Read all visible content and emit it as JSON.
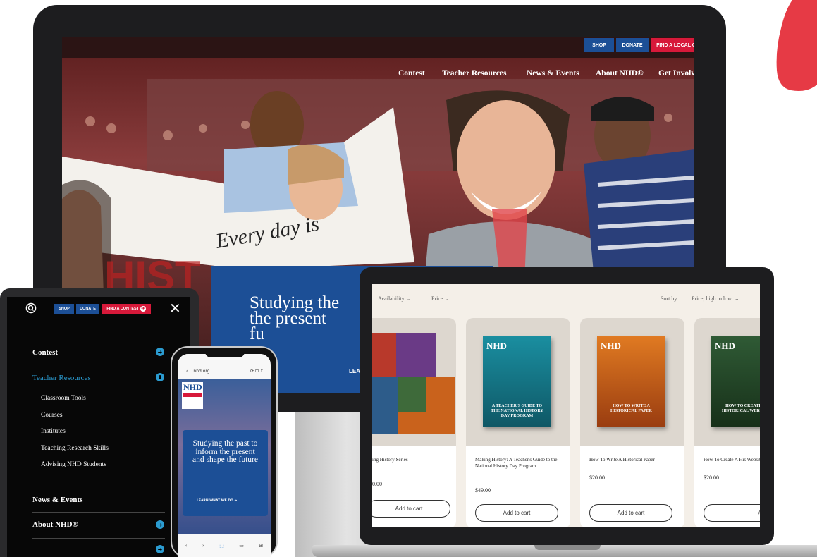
{
  "desktop_site": {
    "top_buttons": [
      {
        "label": "SHOP",
        "color": "#1c4f96"
      },
      {
        "label": "DONATE",
        "color": "#1c4f96"
      },
      {
        "label": "FIND A LOCAL C",
        "color": "#d7193a"
      }
    ],
    "nav": [
      "Contest",
      "Teacher Resources",
      "News & Events",
      "About NHD®",
      "Get Involv"
    ],
    "banner_text": "Every day is",
    "hero_title": "Studying the past to inform the present and shape the future",
    "hero_title_visible": "Studying the\nthe present\nfu",
    "hero_link": "LEARN"
  },
  "shop_page": {
    "filters": {
      "availability": "Availability",
      "price": "Price",
      "sort_label": "Sort by:",
      "sort_value": "Price, high to low"
    },
    "products": [
      {
        "title": "Making History Series",
        "title_visible": "ing History Series",
        "price_visible": "0.00",
        "button": "Add to cart"
      },
      {
        "title": "Making History: A Teacher's Guide to the National History Day Program",
        "price": "$49.00",
        "button": "Add to cart",
        "cover_title": "A TEACHER'S GUIDE TO THE NATIONAL HISTORY DAY PROGRAM"
      },
      {
        "title": "How To Write A Historical Paper",
        "price": "$20.00",
        "button": "Add to cart",
        "cover_title": "HOW TO WRITE A HISTORICAL PAPER"
      },
      {
        "title": "How To Create A Historical Website",
        "title_visible": "How To Create A His Website",
        "price": "$20.00",
        "button": "Add to ca",
        "cover_title": "HOW TO CREATE A HISTORICAL WEBSITE"
      }
    ]
  },
  "tablet_menu": {
    "top_buttons": [
      "SHOP",
      "DONATE",
      "FIND A CONTEST"
    ],
    "items": [
      {
        "label": "Contest"
      },
      {
        "label": "Teacher Resources",
        "active": true,
        "children": [
          "Classroom Tools",
          "Courses",
          "Institutes",
          "Teaching Research Skills",
          "Advising NHD Students"
        ]
      },
      {
        "label": "News & Events"
      },
      {
        "label": "About NHD®"
      }
    ]
  },
  "phone_site": {
    "url": "nhd.org",
    "hero_title": "Studying the past to inform the present and shape the future",
    "hero_link": "LEARN WHAT WE DO"
  },
  "colors": {
    "nhd_blue": "#1c4f96",
    "nhd_red": "#d7193a",
    "menu_accent": "#2b9bd0",
    "brush_red": "#e63a45"
  }
}
